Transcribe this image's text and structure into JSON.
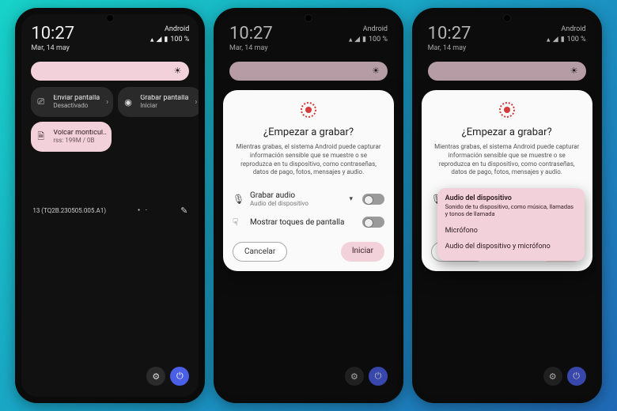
{
  "status": {
    "clock": "10:27",
    "date": "Mar, 14 may",
    "carrier": "Android",
    "battery": "100 %"
  },
  "tiles": {
    "cast": {
      "title": "Enviar pantalla",
      "sub": "Desactivado"
    },
    "record": {
      "title": "Grabar pantalla",
      "sub": "Iniciar"
    },
    "heap": {
      "title": "Volcar montícul..",
      "sub": "rss: 199M / 0B"
    }
  },
  "build_row": {
    "build": "13 (TQ2B.230505.005.A1)"
  },
  "dialog": {
    "title": "¿Empezar a grabar?",
    "body": "Mientras grabas, el sistema Android puede capturar información sensible que se muestre o se reproduzca en tu dispositivo, como contraseñas, datos de pago, fotos, mensajes y audio.",
    "audio": {
      "title": "Grabar audio",
      "sub": "Audio del dispositivo"
    },
    "touches": {
      "title": "Mostrar toques de pantalla"
    },
    "cancel": "Cancelar",
    "start": "Iniciar"
  },
  "audio_menu": {
    "device": {
      "title": "Audio del dispositivo",
      "sub": "Sonido de tu dispositivo, como música, llamadas y tonos de llamada"
    },
    "mic": "Micrófono",
    "both": "Audio del dispositivo y micrófono"
  },
  "ghost_tile": "Enviar pantalla"
}
